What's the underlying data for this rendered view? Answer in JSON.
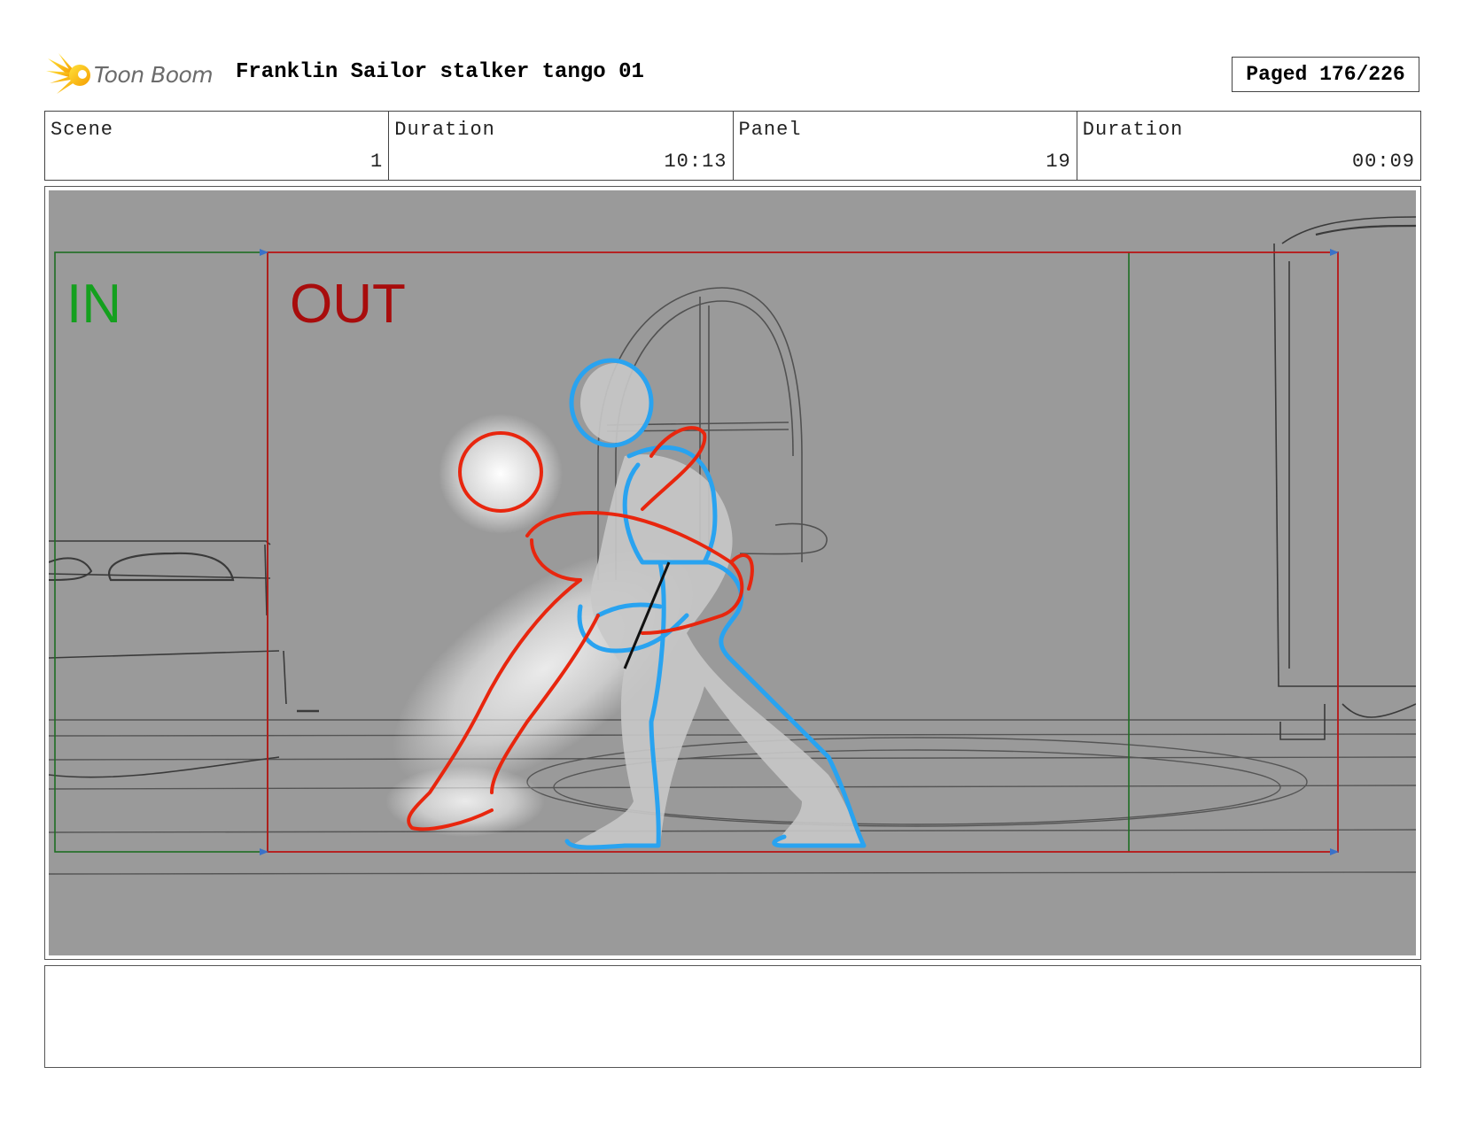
{
  "header": {
    "logo_text": "Toon Boom",
    "title": "Franklin Sailor stalker tango 01",
    "page_label": "Paged 176/226"
  },
  "info": {
    "scene_label": "Scene",
    "scene_value": "1",
    "scene_duration_label": "Duration",
    "scene_duration_value": "10:13",
    "panel_label": "Panel",
    "panel_value": "19",
    "panel_duration_label": "Duration",
    "panel_duration_value": "00:09"
  },
  "panel": {
    "in_label": "IN",
    "out_label": "OUT"
  },
  "colors": {
    "in_marker": "#14a01e",
    "out_marker": "#a80c0c",
    "background_gray": "#9a9a9a",
    "sketch_blue": "#29a3f0",
    "sketch_red": "#e8260e"
  },
  "notes": {
    "text": ""
  }
}
